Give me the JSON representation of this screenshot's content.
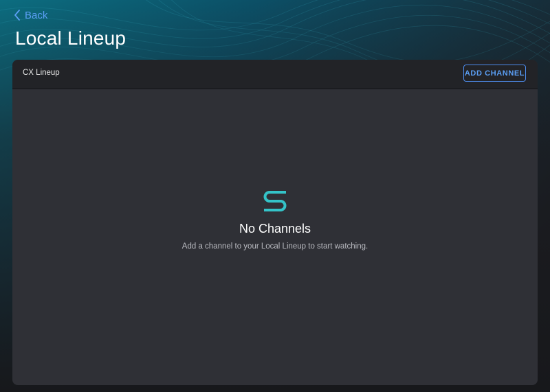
{
  "nav": {
    "back_label": "Back"
  },
  "page": {
    "title": "Local Lineup"
  },
  "panel": {
    "title": "CX Lineup",
    "add_button_label": "ADD CHANNEL"
  },
  "empty_state": {
    "logo_icon": "channels-s-logo-icon",
    "title": "No Channels",
    "message": "Add a channel to your Local Lineup to start watching."
  },
  "colors": {
    "accent": "#5b9ff5",
    "logo": "#34c3c8",
    "panel_bg": "#2f3036",
    "header_bg": "#222327"
  }
}
